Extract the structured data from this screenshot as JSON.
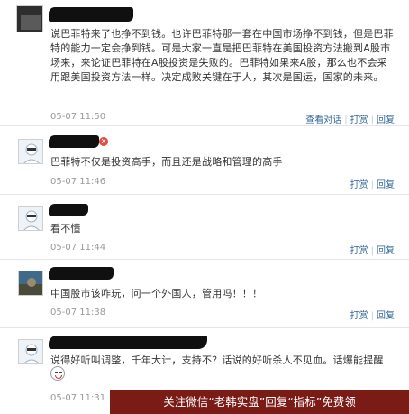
{
  "comments": [
    {
      "text": "说巴菲特来了也挣不到钱。也许巴菲特那一套在中国市场挣不到钱，但是巴菲特的能力一定会挣到钱。可是大家一直是把巴菲特在美国投资方法搬到A股市场来，来论证巴菲特在A股投资是失败的。巴菲特如果来A股，那么也不会采用跟美国投资方法一样。决定成败关键在于人，其次是国运，国家的未来。",
      "time": "05-07 11:50",
      "actions": [
        "查看对话",
        "打赏",
        "回复"
      ]
    },
    {
      "text": "巴菲特不仅是投资高手，而且还是战略和管理的高手",
      "time": "05-07 11:46",
      "actions": [
        "打赏",
        "回复"
      ]
    },
    {
      "text": "看不懂",
      "time": "05-07 11:44",
      "actions": [
        "打赏",
        "回复"
      ]
    },
    {
      "text": "中国股市该咋玩，问一个外国人，管用吗！！！",
      "time": "05-07 11:38",
      "actions": [
        "打赏",
        "回复"
      ]
    },
    {
      "text": "说得好听叫调整，千年大计，支持不？话说的好听杀人不见血。话爆能提醒",
      "time": "05-07 11:31",
      "actions": []
    }
  ],
  "banner": {
    "text": "关注微信“老韩实盘”回复“指标”免费领"
  },
  "icons": {
    "default_avatar": "default-avatar-icon",
    "emoji": "grin-emoji-icon",
    "close": "close-icon"
  }
}
